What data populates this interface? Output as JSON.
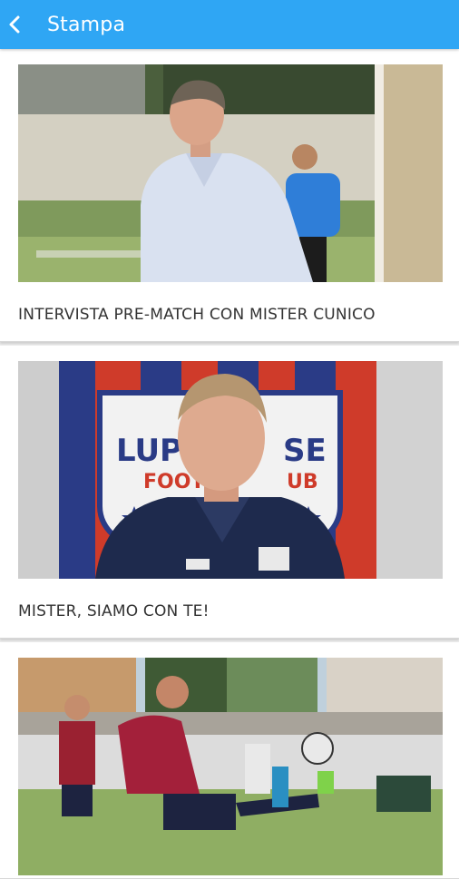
{
  "header": {
    "title": "Stampa",
    "background_color": "#2fa6f4",
    "back_icon": "chevron-left-icon"
  },
  "articles": [
    {
      "title": "INTERVISTA PRE-MATCH CON MISTER CUNICO"
    },
    {
      "title": "MISTER, SIAMO CON TE!"
    },
    {
      "title": ""
    }
  ],
  "crest": {
    "line1": "LUP",
    "line1b": "SE",
    "line2": "FOOT",
    "line2b": "UB"
  }
}
